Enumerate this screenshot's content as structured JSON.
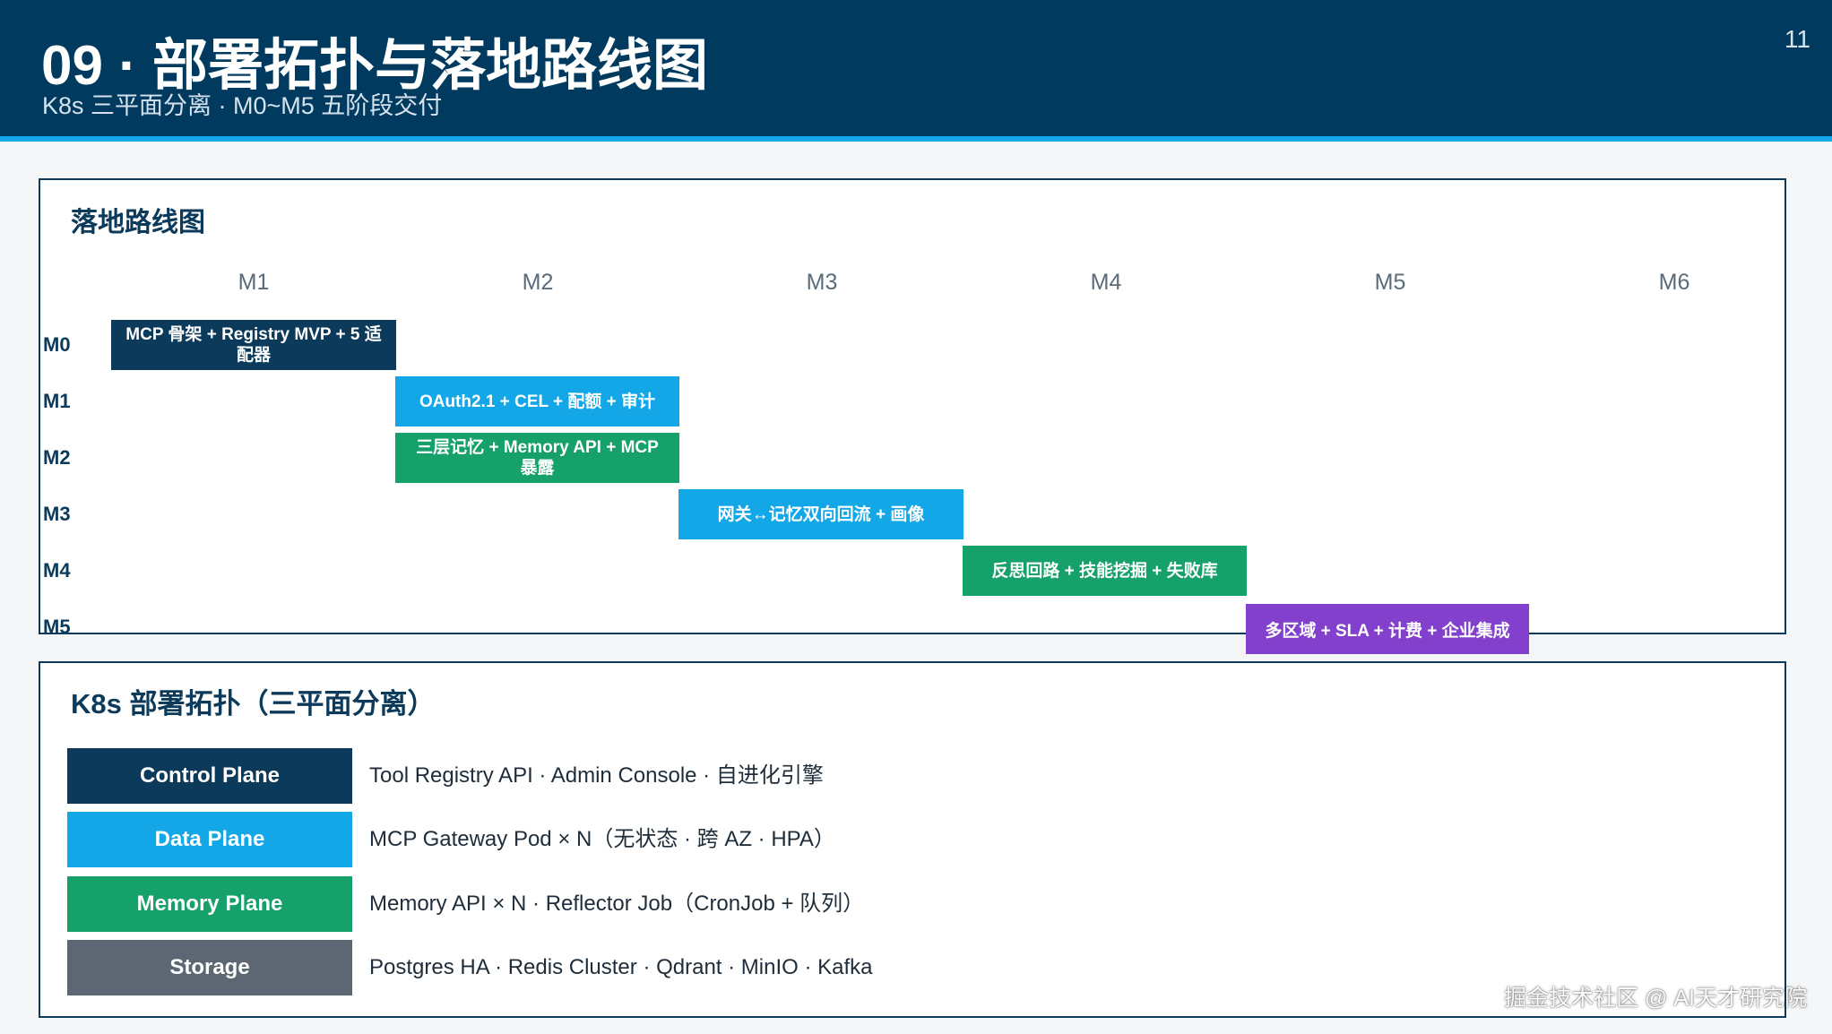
{
  "header": {
    "title": "09 · 部署拓扑与落地路线图",
    "subtitle": "K8s 三平面分离 · M0~M5 五阶段交付",
    "page_number": "11"
  },
  "roadmap": {
    "title": "落地路线图",
    "columns": [
      "M1",
      "M2",
      "M3",
      "M4",
      "M5",
      "M6"
    ],
    "rows": [
      "M0",
      "M1",
      "M2",
      "M3",
      "M4",
      "M5"
    ],
    "bars": [
      {
        "row": "M0",
        "label": "MCP 骨架 + Registry MVP + 5 适配器",
        "color": "#0c3a5b"
      },
      {
        "row": "M1",
        "label": "OAuth2.1 + CEL + 配额 + 审计",
        "color": "#13a7e8"
      },
      {
        "row": "M2",
        "label": "三层记忆 + Memory API + MCP 暴露",
        "color": "#16a06a"
      },
      {
        "row": "M3",
        "label": "网关↔记忆双向回流 + 画像",
        "color": "#13a7e8"
      },
      {
        "row": "M4",
        "label": "反思回路 + 技能挖掘 + 失败库",
        "color": "#16a06a"
      },
      {
        "row": "M5",
        "label": "多区域 + SLA + 计费 + 企业集成",
        "color": "#8240cc"
      }
    ]
  },
  "topology": {
    "title": "K8s 部署拓扑（三平面分离）",
    "planes": [
      {
        "label": "Control Plane",
        "color": "#0c3a5b",
        "description": "Tool Registry API · Admin Console · 自进化引擎"
      },
      {
        "label": "Data Plane",
        "color": "#13a7e8",
        "description": "MCP Gateway Pod × N（无状态 · 跨 AZ · HPA）"
      },
      {
        "label": "Memory Plane",
        "color": "#16a06a",
        "description": "Memory API × N · Reflector Job（CronJob + 队列）"
      },
      {
        "label": "Storage",
        "color": "#5d6673",
        "description": "Postgres HA · Redis Cluster · Qdrant · MinIO · Kafka"
      }
    ]
  },
  "watermark": "掘金技术社区 @ AI天才研究院"
}
